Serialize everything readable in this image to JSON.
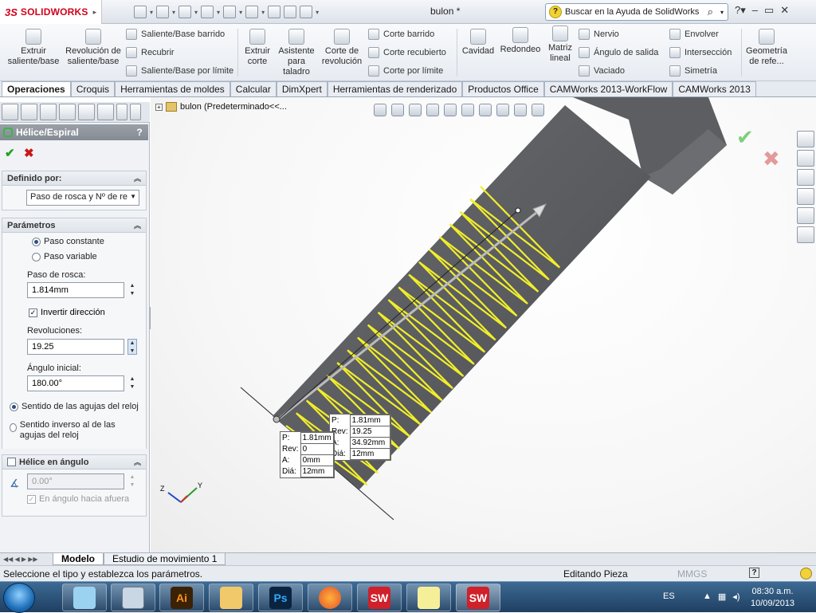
{
  "titlebar": {
    "logo_prefix": "3S",
    "logo_text": "SOLIDWORKS",
    "doc_title": "bulon *",
    "help_search": "Buscar en la Ayuda de SolidWorks"
  },
  "cmd": {
    "extrude": "Extruir saliente/base",
    "revolve": "Revolución de saliente/base",
    "sweep": "Saliente/Base barrido",
    "loft": "Recubrir",
    "boundary": "Saliente/Base por límite",
    "ext_cut": "Extruir corte",
    "hole_wizard": "Asistente para taladro",
    "rev_cut": "Corte de revolución",
    "swept_cut": "Corte barrido",
    "lofted_cut": "Corte recubierto",
    "boundary_cut": "Corte por límite",
    "cavity": "Cavidad",
    "fillet": "Redondeo",
    "linear_pattern": "Matriz lineal",
    "rib": "Nervio",
    "draft": "Ángulo de salida",
    "shell": "Vaciado",
    "wrap": "Envolver",
    "intersect": "Intersección",
    "mirror": "Simetría",
    "ref_geometry": "Geometría de refe..."
  },
  "tabs": [
    "Operaciones",
    "Croquis",
    "Herramientas de moldes",
    "Calcular",
    "DimXpert",
    "Herramientas de renderizado",
    "Productos Office",
    "CAMWorks 2013-WorkFlow",
    "CAMWorks 2013"
  ],
  "pm": {
    "title": "Hélice/Espiral",
    "help": "?",
    "defined_by_title": "Definido por:",
    "defined_by_value": "Paso de rosca y Nº de re",
    "params_title": "Parámetros",
    "constant_pitch": "Paso constante",
    "variable_pitch": "Paso variable",
    "pitch_label": "Paso de rosca:",
    "pitch_value": "1.814mm",
    "reverse_label": "Invertir dirección",
    "revs_label": "Revoluciones:",
    "revs_value": "19.25",
    "start_angle_label": "Ángulo inicial:",
    "start_angle_value": "180.00°",
    "clockwise": "Sentido de las agujas del reloj",
    "counterclockwise": "Sentido inverso al de las agujas del reloj",
    "taper_title": "Hélice en ángulo",
    "taper_value": "0.00°",
    "taper_outward": "En ángulo hacia afuera"
  },
  "viewport": {
    "tree_label": "bulon  (Predeterminado<<...",
    "callout_start": {
      "p": "1.81mm",
      "rev": "0",
      "a": "0mm",
      "dia": "12mm"
    },
    "callout_end": {
      "p": "1.81mm",
      "rev": "19.25",
      "a": "34.92mm",
      "dia": "12mm"
    },
    "labels": {
      "p": "P:",
      "rev": "Rev:",
      "a": "A:",
      "dia": "Diá:"
    }
  },
  "bottom_tabs": [
    "Modelo",
    "Estudio de movimiento 1"
  ],
  "status": {
    "message": "Seleccione el tipo y establezca los parámetros.",
    "mode": "Editando Pieza",
    "units": "MMGS"
  },
  "taskbar": {
    "apps": [
      "Ai",
      "Ps",
      "SW",
      "SW"
    ],
    "lang": "ES",
    "time": "08:30 a.m.",
    "date": "10/09/2013"
  },
  "colors": {
    "helix": "#f1ee2a",
    "bolt": "#5d5f63",
    "brand": "#d0021b"
  }
}
